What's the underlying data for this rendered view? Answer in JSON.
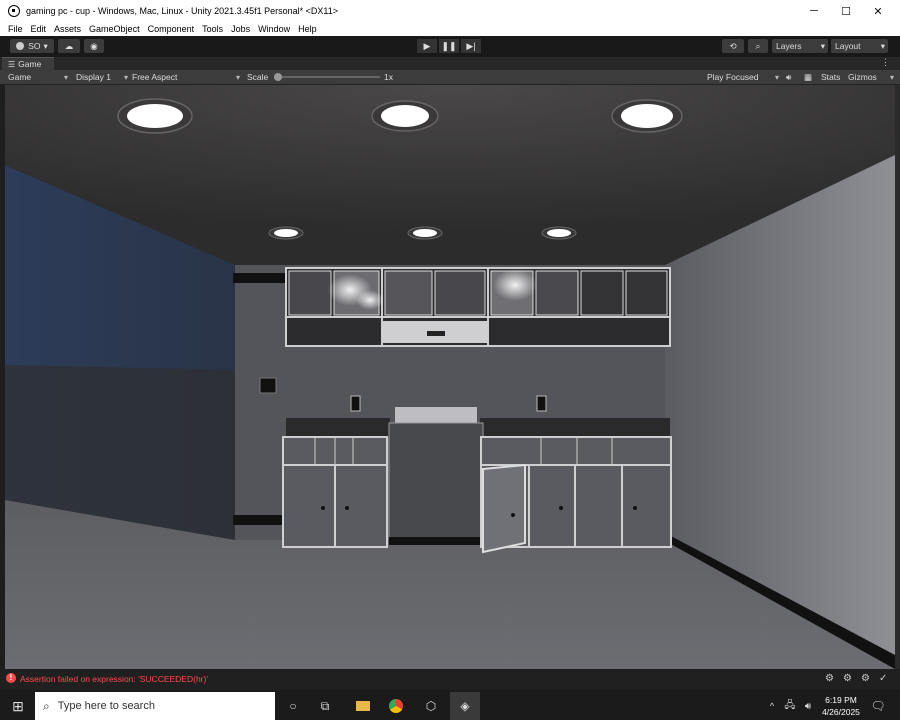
{
  "window": {
    "title": "gaming pc - cup - Windows, Mac, Linux - Unity 2021.3.45f1 Personal* <DX11>",
    "minimize": "─",
    "maximize": "☐",
    "close": "✕"
  },
  "menu": [
    "File",
    "Edit",
    "Assets",
    "GameObject",
    "Component",
    "Tools",
    "Jobs",
    "Window",
    "Help"
  ],
  "toolbar": {
    "account_label": "SO",
    "layers_label": "Layers",
    "layout_label": "Layout"
  },
  "game_tab": {
    "label": "Game",
    "kebab": "⋮"
  },
  "game_toolbar": {
    "view_mode": "Game",
    "display": "Display 1",
    "aspect": "Free Aspect",
    "scale_label": "Scale",
    "scale_value": "1x",
    "scale_fraction": 0.0,
    "play_mode": "Play Focused",
    "stats_label": "Stats",
    "gizmos_label": "Gizmos"
  },
  "status": {
    "message": "Assertion failed on expression: 'SUCCEEDED(hr)'",
    "color": "#ff4a4a"
  },
  "taskbar": {
    "search_placeholder": "Type here to search",
    "time": "6:19 PM",
    "date": "4/26/2025"
  }
}
